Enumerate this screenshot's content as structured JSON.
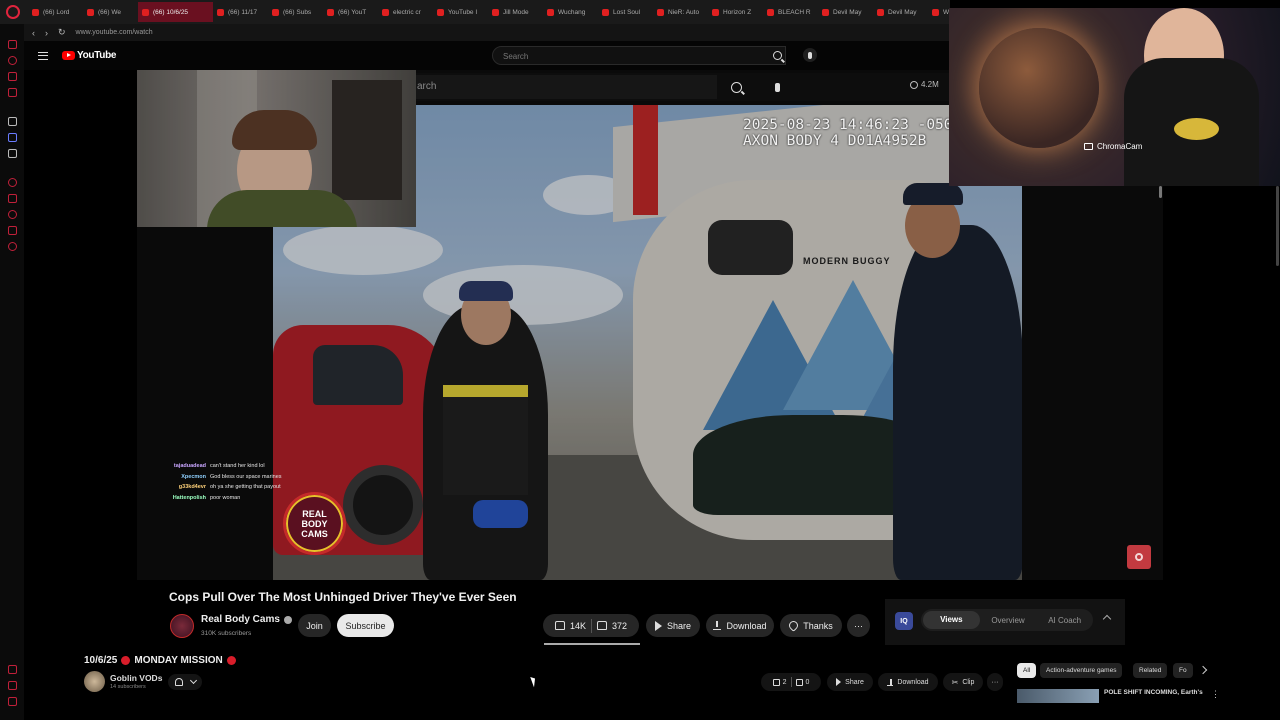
{
  "browser": {
    "tabs": [
      "(66) Lord",
      "(66) We",
      "(66) 10/6/25",
      "(66) 11/17",
      "(66) Subs",
      "(66) YouT",
      "electric cr",
      "YouTube I",
      "Jill Mode",
      "Wuchang",
      "Lost Soul",
      "NieR: Auto",
      "Horizon Z",
      "BLEACH R",
      "Devil May",
      "Devil May",
      "W"
    ],
    "active_tab_index": 2,
    "url": "www.youtube.com/watch"
  },
  "youtube": {
    "logo_text": "YouTube",
    "search_placeholder": "Search"
  },
  "inner_page": {
    "search_text": "arch",
    "views_count": "4.2M"
  },
  "video": {
    "bodycam_timestamp": "2025-08-23 14:46:23 -050\nAXON BODY 4 D01A4952B",
    "trailer_brand": "MODERN BUGGY",
    "badge_text": "REAL\nBODY\nCAMS",
    "title": "Cops Pull Over The Most Unhinged Driver They've Ever Seen",
    "channel_name": "Real Body Cams",
    "channel_subs": "310K subscribers",
    "join_label": "Join",
    "subscribe_label": "Subscribe",
    "likes": "14K",
    "dislikes": "372",
    "share_label": "Share",
    "download_label": "Download",
    "thanks_label": "Thanks",
    "more_label": "···"
  },
  "extension": {
    "logo": "IQ",
    "tabs": [
      "Views",
      "Overview",
      "AI Coach"
    ],
    "active_tab": "Views"
  },
  "webcam": {
    "label": "ChromaCam"
  },
  "chat": [
    {
      "user": "tajaduadead",
      "msg": "can't stand her kind lol",
      "color": "#c9a6ff"
    },
    {
      "user": "Xpecmon",
      "msg": "God bless our space marines",
      "color": "#8fd0ff"
    },
    {
      "user": "g33kd4evr",
      "msg": "oh ya she getting that payout",
      "color": "#ffd27a"
    },
    {
      "user": "Hattenpolish",
      "msg": "poor woman",
      "color": "#9affc0"
    }
  ],
  "stream": {
    "title": "10/6/25",
    "title_rest": "MONDAY MISSION",
    "channel_name": "Goblin VODs",
    "channel_subs": "14 subscribers",
    "likes": "2",
    "dislikes": "0",
    "share_label": "Share",
    "download_label": "Download",
    "clip_label": "Clip",
    "more_label": "···"
  },
  "chips": [
    "All",
    "Action-adventure games",
    "Related",
    "Fo"
  ],
  "recommended": {
    "title": "POLE SHIFT INCOMING, Earth's"
  },
  "colors": {
    "accent_red": "#d81d2a",
    "browser_active_tab": "#6a1020",
    "record_button": "#c23a40"
  }
}
